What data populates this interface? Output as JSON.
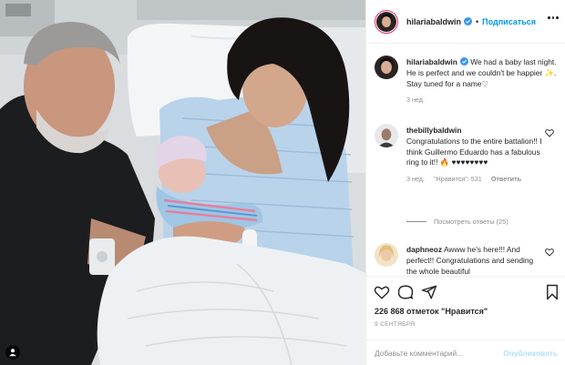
{
  "photo": {
    "alt_subject": "hospital-newborn-photo"
  },
  "header": {
    "username": "hilariabaldwin",
    "separator": "•",
    "follow_label": "Подписаться",
    "more_icon": "more-horizontal-icon"
  },
  "caption": {
    "username": "hilariabaldwin",
    "text": "We had a baby last night. He is perfect and we couldn't be happier ✨. Stay tuned for a name♡",
    "time": "3 нед."
  },
  "comments": [
    {
      "username": "thebillybaldwin",
      "text": "Congratulations to the entire battalion!! I think Guillermo Eduardo has a fabulous ring to it!! 🔥 ♥♥♥♥♥♥♥♥",
      "time": "3 нед.",
      "likes": "\"Нравится\": 531",
      "reply": "Ответить",
      "view_replies": "Посмотреть ответы (25)"
    },
    {
      "username": "daphneoz",
      "text": "Awww he's here!!! And perfect!! Congratulations and sending the whole beautiful"
    }
  ],
  "actions": {
    "likes": "226 868 отметок \"Нравится\"",
    "date": "9 СЕНТЯБРЯ",
    "comment_placeholder": "Добавьте комментарий...",
    "publish_label": "Опубликовать"
  },
  "colors": {
    "accent": "#0095f6",
    "publish_disabled": "#b2dffc",
    "muted": "#8e8e8e",
    "text": "#262626"
  }
}
